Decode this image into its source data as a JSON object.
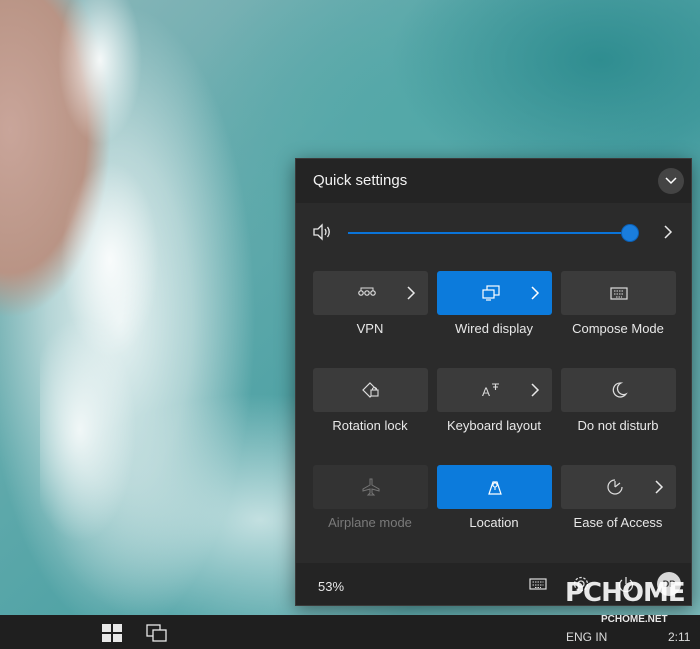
{
  "panel": {
    "title": "Quick settings",
    "volume_percent": 100
  },
  "tiles": [
    {
      "label": "VPN",
      "icon": "vpn-icon",
      "on": false,
      "has_more": true,
      "disabled": false
    },
    {
      "label": "Wired display",
      "icon": "display-icon",
      "on": true,
      "has_more": true,
      "disabled": false
    },
    {
      "label": "Compose Mode",
      "icon": "keyboard-icon",
      "on": false,
      "has_more": false,
      "disabled": false
    },
    {
      "label": "Rotation lock",
      "icon": "rotation-lock-icon",
      "on": false,
      "has_more": false,
      "disabled": false
    },
    {
      "label": "Keyboard layout",
      "icon": "keyboard-layout-icon",
      "on": false,
      "has_more": true,
      "disabled": false
    },
    {
      "label": "Do not disturb",
      "icon": "moon-icon",
      "on": false,
      "has_more": false,
      "disabled": false
    },
    {
      "label": "Airplane mode",
      "icon": "airplane-icon",
      "on": false,
      "has_more": false,
      "disabled": true
    },
    {
      "label": "Location",
      "icon": "location-icon",
      "on": true,
      "has_more": false,
      "disabled": false
    },
    {
      "label": "Ease of Access",
      "icon": "accessibility-icon",
      "on": false,
      "has_more": true,
      "disabled": false
    }
  ],
  "footer": {
    "battery": "53%",
    "avatar_initials": "DP"
  },
  "taskbar": {
    "language": "ENG IN",
    "time": "2:11"
  },
  "watermark": {
    "logo": "PCHOME",
    "url": "PCHOME.NET"
  },
  "colors": {
    "accent": "#0c7bdc",
    "panel_bg": "#2b2b2b",
    "tile_bg": "#3b3b3b"
  }
}
